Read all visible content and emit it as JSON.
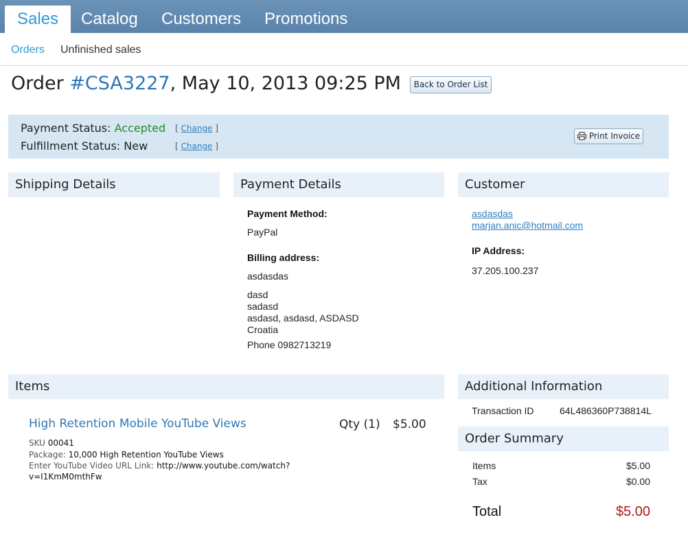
{
  "nav": {
    "tabs": [
      "Sales",
      "Catalog",
      "Customers",
      "Promotions"
    ],
    "sub": [
      "Orders",
      "Unfinished sales"
    ]
  },
  "order": {
    "prefix": "Order ",
    "number": "#CSA3227",
    "datetime": ", May 10, 2013 09:25 PM",
    "back_button": "Back to Order List"
  },
  "status": {
    "payment_label": "Payment Status: ",
    "payment_value": "Accepted",
    "fulfillment_label": "Fulfillment Status: ",
    "fulfillment_value": "New",
    "change_label": "Change",
    "print_button": "Print Invoice"
  },
  "shipping": {
    "title": "Shipping Details"
  },
  "payment": {
    "title": "Payment Details",
    "method_label": "Payment Method:",
    "method": "PayPal",
    "billing_label": "Billing address:",
    "billing_name": "asdasdas",
    "address_lines": [
      "dasd",
      "sadasd",
      "asdasd, asdasd, ASDASD",
      "Croatia"
    ],
    "phone": "Phone 0982713219"
  },
  "customer": {
    "title": "Customer",
    "name": "asdasdas",
    "email": "marjan.anic@hotmail.com",
    "ip_label": "IP Address:",
    "ip": "37.205.100.237"
  },
  "items": {
    "title": "Items",
    "list": [
      {
        "name": "High Retention Mobile YouTube Views",
        "qty": "Qty (1)",
        "price": "$5.00",
        "sku_label": "SKU ",
        "sku": "00041",
        "package_label": "Package: ",
        "package": "10,000 High Retention YouTube Views",
        "url_label": "Enter YouTube Video URL Link: ",
        "url_line1": "http://www.youtube.com/watch?",
        "url_line2": "v=I1KmM0mthFw"
      }
    ]
  },
  "additional": {
    "title": "Additional Information",
    "transaction_label": "Transaction ID",
    "transaction_id": "64L486360P738814L"
  },
  "summary": {
    "title": "Order Summary",
    "items_label": "Items",
    "items_value": "$5.00",
    "tax_label": "Tax",
    "tax_value": "$0.00",
    "total_label": "Total",
    "total_value": "$5.00"
  },
  "colors": {
    "accent": "#2f9ad0",
    "nav_bar": "#5a83ab",
    "status_bar": "#d6e7f3",
    "accepted": "#258a25",
    "total": "#b01818"
  }
}
